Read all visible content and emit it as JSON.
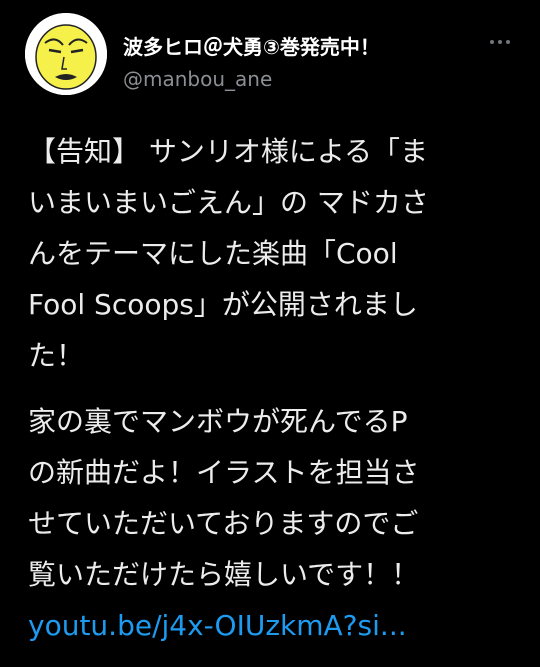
{
  "author": {
    "display_name": "波多ヒロ＠犬勇③巻発売中！",
    "handle": "@manbou_ane",
    "avatar_icon": "yellow-face-avatar"
  },
  "tweet": {
    "line1": "【告知】 サンリオ様による「ま",
    "line2": "いまいまいごえん」の マドカさ",
    "line3": "んをテーマにした楽曲「Cool",
    "line4": "Fool Scoops」が公開されまし",
    "line5": "た！",
    "line6": "家の裏でマンボウが死んでるP",
    "line7": "の新曲だよ！イラストを担当さ",
    "line8": "せていただいておりますのでご",
    "line9": "覧いただけたら嬉しいです！！",
    "link": "youtu.be/j4x-OIUzkmA?si..."
  },
  "colors": {
    "background": "#000000",
    "link": "#1d9bf0",
    "avatar_face": "#f5f04a"
  }
}
